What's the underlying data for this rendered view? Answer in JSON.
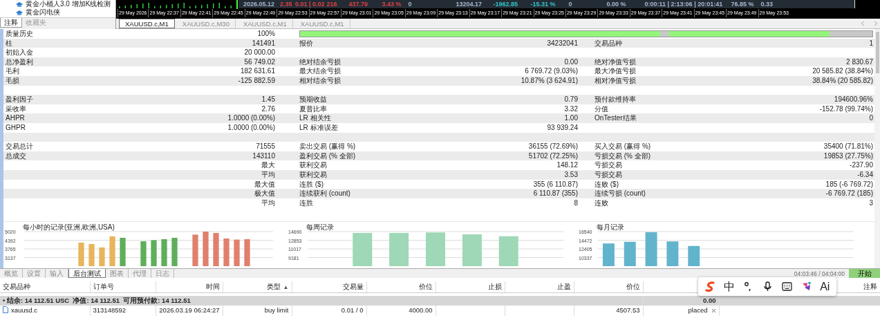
{
  "navigator": {
    "items": [
      {
        "label": "黄金小桶人3.0 增加K线检测"
      },
      {
        "label": "黄金闪电侠"
      }
    ],
    "tabs": [
      {
        "label": "注释",
        "selected": true
      },
      {
        "label": "收藏夹",
        "selected": false
      }
    ]
  },
  "chart_window": {
    "info": [
      {
        "text": "2026.05.12",
        "color": "#a8b8d0"
      },
      {
        "text": "2.35",
        "color": "#e04040"
      },
      {
        "text": "0.01 | 0.02",
        "color": "#e04040"
      },
      {
        "text": "216",
        "color": "#e04040"
      },
      {
        "text": "437.79",
        "color": "#e04040"
      },
      {
        "text": "3.43 %",
        "color": "#e04040"
      },
      {
        "text": "0",
        "color": "#a8b8d0"
      },
      {
        "text": "13204.17",
        "color": "#a8b8d0"
      },
      {
        "text": "-1962.85",
        "color": "#30c8c8"
      },
      {
        "text": "-15.31 %",
        "color": "#30c8c8"
      },
      {
        "text": "0",
        "color": "#a8b8d0"
      },
      {
        "text": "0.00 %",
        "color": "#a8b8d0"
      },
      {
        "text": "0:00:11 | 2:13:06 | 20:01:41",
        "color": "#a8b8d0"
      },
      {
        "text": "76.85 %",
        "color": "#a8b8d0"
      },
      {
        "text": "0.33",
        "color": "#a8b8d0"
      }
    ],
    "time_axis": [
      "29 May 2026",
      "29 May 22:37",
      "29 May 22:41",
      "29 May 22:45",
      "29 May 22:49",
      "29 May 22:53",
      "29 May 22:57",
      "29 May 23:01",
      "29 May 23:05",
      "29 May 23:09",
      "29 May 23:13",
      "29 May 23:17",
      "29 May 23:21",
      "29 May 23:25",
      "29 May 23:29",
      "29 May 23:33",
      "29 May 23:37",
      "29 May 23:41",
      "29 May 23:45",
      "29 May 23:49",
      "29 May 23:53"
    ],
    "tabs": [
      {
        "label": "XAUUSD.c,M1",
        "selected": true
      },
      {
        "label": "XAUUSD.c,M30",
        "selected": false
      },
      {
        "label": "XAUUSD.c,M1",
        "selected": false
      },
      {
        "label": "XAUUSD.c,M1",
        "selected": false
      }
    ]
  },
  "report": {
    "rows": [
      {
        "kind": "quality",
        "label_1": "质量历史",
        "value_1": "100%"
      },
      {
        "kind": "stat",
        "label_1": "柱",
        "value_1": "141491",
        "label_2": "报价",
        "value_2": "34232041",
        "label_3": "交易品种",
        "value_3": "1"
      },
      {
        "kind": "stat",
        "label_1": "初始入金",
        "value_1": "20 000.00"
      },
      {
        "kind": "stat",
        "label_1": "总净盈利",
        "value_1": "56 749.02",
        "label_2": "绝对结余亏损",
        "value_2": "0.00",
        "label_3": "绝对净值亏损",
        "value_3": "2 830.67"
      },
      {
        "kind": "stat",
        "label_1": "毛利",
        "value_1": "182 631.61",
        "label_2": "最大结余亏损",
        "value_2": "6 769.72 (9.03%)",
        "label_3": "最大净值亏损",
        "value_3": "20 585.82 (38.84%)"
      },
      {
        "kind": "stat",
        "label_1": "毛损",
        "value_1": "-125 882.59",
        "label_2": "相对结余亏损",
        "value_2": "10.87% (3 624.91)",
        "label_3": "相对净值亏损",
        "value_3": "38.84% (20 585.82)"
      },
      {
        "kind": "spacer"
      },
      {
        "kind": "stat",
        "label_1": "盈利因子",
        "value_1": "1.45",
        "label_2": "预期收益",
        "value_2": "0.79",
        "label_3": "预付款维持率",
        "value_3": "194600.96%"
      },
      {
        "kind": "stat",
        "label_1": "采收率",
        "value_1": "2.76",
        "label_2": "夏普比率",
        "value_2": "3.32",
        "label_3": "分值",
        "value_3": "-152.78 (99.74%)"
      },
      {
        "kind": "stat",
        "label_1": "AHPR",
        "value_1": "1.0000 (0.00%)",
        "label_2": "LR 相关性",
        "value_2": "1.00",
        "label_3": "OnTester结果",
        "value_3": "0"
      },
      {
        "kind": "stat",
        "label_1": "GHPR",
        "value_1": "1.0000 (0.00%)",
        "label_2": "LR 标准误差",
        "value_2": "93 939.24"
      },
      {
        "kind": "spacer"
      },
      {
        "kind": "stat",
        "label_1": "交易总计",
        "value_1": "71555",
        "label_2": "卖出交易 (赢得 %)",
        "value_2": "36155 (72.69%)",
        "label_3": "买入交易 (赢得 %)",
        "value_3": "35400 (71.81%)"
      },
      {
        "kind": "stat",
        "label_1": "总成交",
        "value_1": "143110",
        "label_2": "盈利交易 (% 全部)",
        "value_2": "51702 (72.25%)",
        "label_3": "亏损交易 (% 全部)",
        "value_3": "19853 (27.75%)"
      },
      {
        "kind": "stat",
        "value_1": "最大",
        "label_2": "获利交易",
        "value_2": "148.12",
        "label_3": "亏损交易",
        "value_3": "-237.90"
      },
      {
        "kind": "stat",
        "value_1": "平均",
        "label_2": "获利交易",
        "value_2": "3.53",
        "label_3": "亏损交易",
        "value_3": "-6.34"
      },
      {
        "kind": "stat",
        "value_1": "最大值",
        "label_2": "连胜 ($)",
        "value_2": "355 (6 110.87)",
        "label_3": "连败 ($)",
        "value_3": "185 (-6 769.72)"
      },
      {
        "kind": "stat",
        "value_1": "极大值",
        "label_2": "连续获利 (count)",
        "value_2": "6 110.87 (355)",
        "label_3": "连续亏损 (count)",
        "value_3": "-6 769.72 (185)"
      },
      {
        "kind": "stat",
        "value_1": "平均",
        "label_2": "连胜",
        "value_2": "8",
        "label_3": "连败",
        "value_3": "3"
      }
    ]
  },
  "graphs": [
    {
      "title": "每小时的记录(亚洲,欧洲,USA)",
      "chart_data": {
        "type": "bar",
        "grid": true,
        "ylim": [
          2512,
          5020
        ],
        "yticks": [
          3137,
          3765,
          4392,
          5020
        ],
        "series": [
          {
            "color": "#e8b45c",
            "values": [
              null,
              null,
              null,
              null,
              null,
              4220,
              4120,
              3870,
              4670,
              null,
              null,
              null,
              null,
              null,
              null,
              null,
              null,
              null,
              null,
              null,
              null,
              null,
              null,
              null
            ]
          },
          {
            "color": "#5fae5a",
            "values": [
              null,
              null,
              null,
              null,
              null,
              null,
              null,
              null,
              null,
              4570,
              null,
              4320,
              4400,
              4470,
              4570,
              null,
              null,
              null,
              null,
              null,
              null,
              null,
              null,
              null
            ]
          },
          {
            "color": "#e0806c",
            "values": [
              null,
              null,
              null,
              null,
              null,
              null,
              null,
              null,
              null,
              null,
              null,
              null,
              null,
              null,
              null,
              null,
              4800,
              5020,
              4920,
              4520,
              4440,
              4470,
              null,
              null
            ]
          }
        ]
      }
    },
    {
      "title": "每周记录",
      "chart_data": {
        "type": "bar",
        "grid": true,
        "ylim": [
          7345,
          14690
        ],
        "yticks": [
          9181,
          11017,
          12853,
          14690
        ],
        "series": [
          {
            "color": "#9ed8b6",
            "values": [
              null,
              14400,
              14400,
              14500,
              14100,
              13700,
              null
            ]
          }
        ]
      }
    },
    {
      "title": "每月记录",
      "chart_data": {
        "type": "bar",
        "grid": true,
        "ylim": [
          8270,
          16540
        ],
        "yticks": [
          10337,
          12405,
          14472,
          16540
        ],
        "series": [
          {
            "color": "#62b4cc",
            "values": [
              13700,
              14100,
              16400,
              14200,
              13100,
              null,
              null,
              null,
              null,
              null,
              null,
              null
            ]
          }
        ]
      }
    }
  ],
  "tester": {
    "tabs": [
      {
        "label": "概览",
        "selected": false
      },
      {
        "label": "设置",
        "selected": false
      },
      {
        "label": "输入",
        "selected": false
      },
      {
        "label": "后台测试",
        "selected": true
      },
      {
        "label": "图表",
        "selected": false
      },
      {
        "label": "代理",
        "selected": false
      },
      {
        "label": "日志",
        "selected": false
      }
    ],
    "elapsed": "04:03:46 / 04:04:00",
    "start_button": "开始"
  },
  "orders": {
    "columns": [
      {
        "label": "交易品种"
      },
      {
        "label": "订单号"
      },
      {
        "label": "时间"
      },
      {
        "label": "类型",
        "sort": "▲"
      },
      {
        "label": "交易量"
      },
      {
        "label": "价位"
      },
      {
        "label": "止损"
      },
      {
        "label": "止盈"
      },
      {
        "label": "价位"
      },
      {},
      {
        "label": "注释"
      }
    ],
    "summary": {
      "text": "• 结余: 14 112.51 USC  净值: 14 112.51  可用预付款: 14 112.51",
      "total": "0.00"
    },
    "rows": [
      {
        "cells": [
          "xauusd.c",
          "313148592",
          "2026.03.19 06:24:27",
          "buy limit",
          "0.01 / 0",
          "4000.00",
          null,
          null,
          "4507.53",
          "placed"
        ]
      }
    ]
  },
  "ime_toolbar": {
    "items": [
      {
        "kind": "logo"
      },
      {
        "kind": "text",
        "text": "中"
      },
      {
        "kind": "punct"
      },
      {
        "kind": "mic"
      },
      {
        "kind": "keyboard"
      },
      {
        "kind": "skin"
      },
      {
        "kind": "text",
        "text": "Ai"
      }
    ]
  }
}
